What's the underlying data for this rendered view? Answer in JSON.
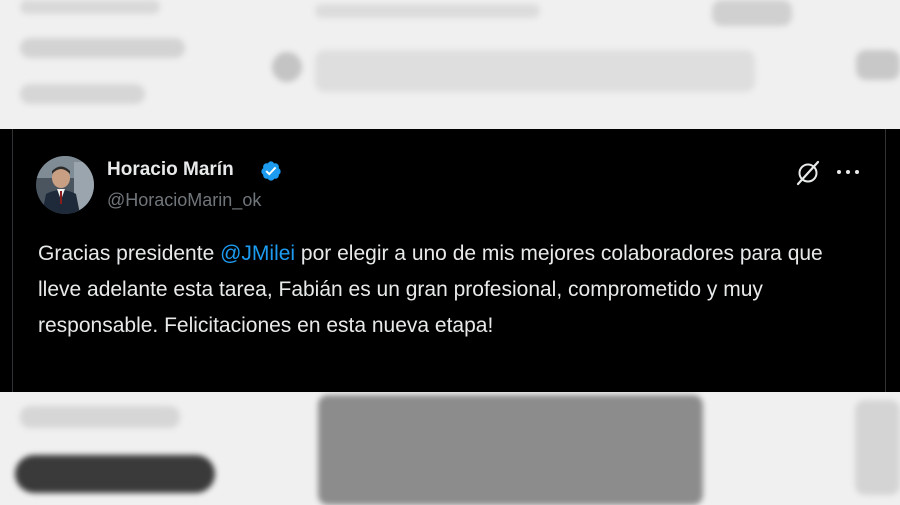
{
  "tweet": {
    "author_name": "Horacio Marín",
    "handle": "@HoracioMarin_ok",
    "text_before": "Gracias presidente ",
    "mention": "@JMilei",
    "text_after": " por elegir a uno de mis mejores colaboradores para que lleve adelante esta tarea, Fabián es un gran profesional, comprometido y muy responsable. Felicitaciones en esta nueva etapa!"
  },
  "icons": {
    "verified": "verified-badge-icon",
    "grok": "grok-icon",
    "more": "more-options-icon"
  },
  "colors": {
    "card_background": "#000000",
    "text": "#e7e9ea",
    "secondary_text": "#71767b",
    "mention": "#1d9bf0",
    "verified_badge": "#1d9bf0"
  }
}
